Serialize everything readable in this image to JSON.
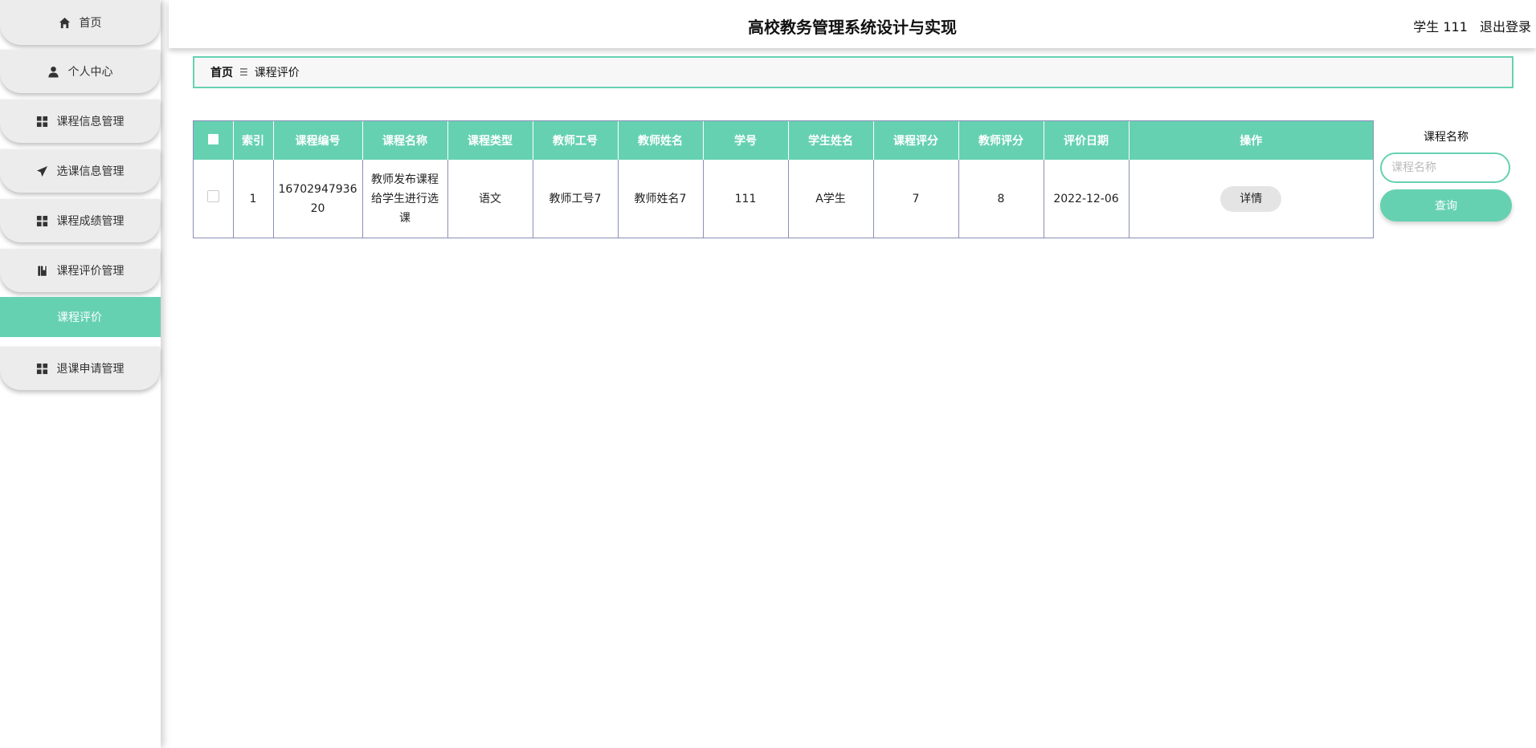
{
  "header": {
    "title": "高校教务管理系统设计与实现",
    "user": "学生 111",
    "logout": "退出登录"
  },
  "sidebar": {
    "items": [
      {
        "label": "首页",
        "icon": "home-icon"
      },
      {
        "label": "个人中心",
        "icon": "user-icon"
      },
      {
        "label": "课程信息管理",
        "icon": "grid-icon"
      },
      {
        "label": "选课信息管理",
        "icon": "send-icon"
      },
      {
        "label": "课程成绩管理",
        "icon": "grid-icon"
      },
      {
        "label": "课程评价管理",
        "icon": "book-icon"
      },
      {
        "label": "退课申请管理",
        "icon": "grid-icon"
      }
    ],
    "active_sub": "课程评价"
  },
  "breadcrumb": {
    "home": "首页",
    "separator": "☰",
    "current": "课程评价"
  },
  "table": {
    "columns": [
      "索引",
      "课程编号",
      "课程名称",
      "课程类型",
      "教师工号",
      "教师姓名",
      "学号",
      "学生姓名",
      "课程评分",
      "教师评分",
      "评价日期",
      "操作"
    ],
    "rows": [
      {
        "index": "1",
        "course_no": "1670294793620",
        "course_name": "教师发布课程给学生进行选课",
        "course_type": "语文",
        "teacher_no": "教师工号7",
        "teacher_name": "教师姓名7",
        "student_no": "111",
        "student_name": "A学生",
        "course_score": "7",
        "teacher_score": "8",
        "date": "2022-12-06",
        "action": "详情"
      }
    ]
  },
  "search": {
    "label": "课程名称",
    "placeholder": "课程名称",
    "button": "查询"
  },
  "colors": {
    "accent": "#66d1b1",
    "menu_bg": "#ececec",
    "table_border": "#8a8fb8"
  }
}
